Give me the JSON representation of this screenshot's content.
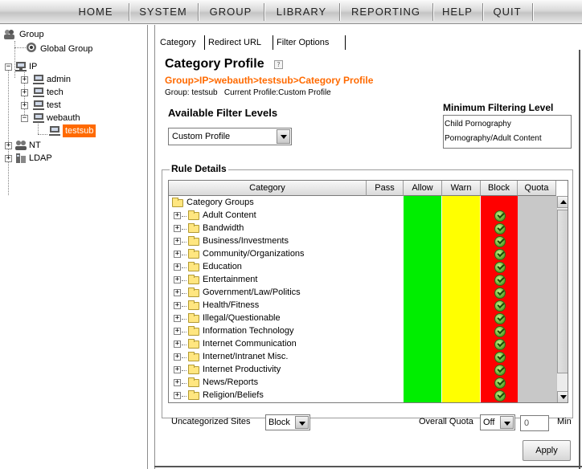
{
  "menu": {
    "items": [
      "HOME",
      "SYSTEM",
      "GROUP",
      "LIBRARY",
      "REPORTING",
      "HELP",
      "QUIT"
    ]
  },
  "tree": {
    "root_label": "Group",
    "global_group": "Global Group",
    "ip_label": "IP",
    "ip_children": [
      "admin",
      "tech",
      "test",
      "webauth"
    ],
    "webauth_child": "testsub",
    "nt_label": "NT",
    "ldap_label": "LDAP"
  },
  "tabs": [
    "Category",
    "Redirect URL",
    "Filter Options"
  ],
  "page": {
    "title": "Category Profile",
    "help_glyph": "?",
    "breadcrumb": "Group>IP>webauth>testsub>Category Profile",
    "group_line": "Group: testsub   Current Profile:Custom Profile"
  },
  "filter_levels": {
    "title": "Available Filter Levels",
    "selected": "Custom Profile"
  },
  "minimum_filtering": {
    "title": "Minimum Filtering Level",
    "items": [
      "Child Pornography",
      "Pornography/Adult Content"
    ]
  },
  "rule_details": {
    "title": "Rule Details",
    "columns": [
      "Category",
      "Pass",
      "Allow",
      "Warn",
      "Block",
      "Quota"
    ],
    "group_row": "Category Groups",
    "rows": [
      "Adult Content",
      "Bandwidth",
      "Business/Investments",
      "Community/Organizations",
      "Education",
      "Entertainment",
      "Government/Law/Politics",
      "Health/Fitness",
      "Illegal/Questionable",
      "Information Technology",
      "Internet Communication",
      "Internet/Intranet Misc.",
      "Internet Productivity",
      "News/Reports",
      "Religion/Beliefs"
    ],
    "colors": {
      "allow": "#00ee00",
      "warn": "#ffff00",
      "block": "#ff0000",
      "quota": "#c8c8c8"
    }
  },
  "bottom": {
    "uncategorized_label": "Uncategorized Sites",
    "uncategorized_value": "Block",
    "overall_quota_label": "Overall Quota",
    "overall_quota_value": "Off",
    "quota_minutes": "0",
    "min_label": "Min",
    "apply_label": "Apply"
  },
  "accent_color": "#ff6a00"
}
